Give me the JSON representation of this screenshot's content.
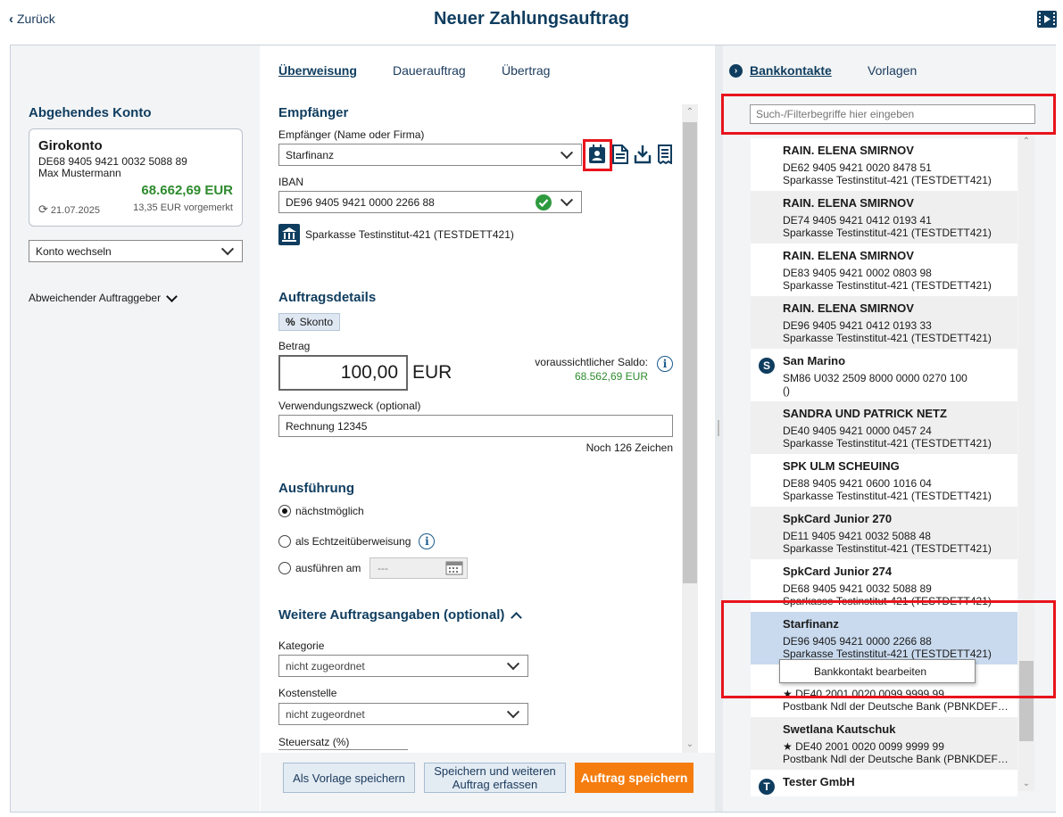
{
  "header": {
    "back_label": "Zurück",
    "title": "Neuer Zahlungsauftrag",
    "media_icon": "film-icon"
  },
  "left": {
    "section_title": "Abgehendes Konto",
    "account": {
      "name": "Girokonto",
      "iban": "DE68 9405 9421 0032 5088 89",
      "holder": "Max Mustermann",
      "balance": "68.662,69 EUR",
      "date": "21.07.2025",
      "preregistered": "13,35 EUR vorgemerkt"
    },
    "switch_account": "Konto wechseln",
    "deviating_payer": "Abweichender Auftraggeber"
  },
  "middle": {
    "tabs": [
      "Überweisung",
      "Dauerauftrag",
      "Übertrag"
    ],
    "recipient": {
      "title": "Empfänger",
      "name_label": "Empfänger (Name oder Firma)",
      "name_value": "Starfinanz",
      "iban_label": "IBAN",
      "iban_value": "DE96 9405 9421 0000 2266 88",
      "bank": "Sparkasse Testinstitut-421  (TESTDETT421)"
    },
    "details": {
      "title": "Auftragsdetails",
      "skonto": "Skonto",
      "amount_label": "Betrag",
      "amount_value": "100,00",
      "currency": "EUR",
      "expected_balance_label": "voraussichtlicher Saldo:",
      "expected_balance_value": "68.562,69 EUR",
      "purpose_label": "Verwendungszweck (optional)",
      "purpose_value": "Rechnung 12345",
      "chars_left": "Noch 126 Zeichen"
    },
    "execution": {
      "title": "Ausführung",
      "options": [
        "nächstmöglich",
        "als Echtzeitüberweisung",
        "ausführen am"
      ],
      "selected_index": 0,
      "date_placeholder": "---"
    },
    "further": {
      "title": "Weitere Auftragsangaben (optional)",
      "category_label": "Kategorie",
      "category_value": "nicht zugeordnet",
      "cost_center_label": "Kostenstelle",
      "cost_center_value": "nicht zugeordnet",
      "tax_label": "Steuersatz (%)"
    },
    "buttons": {
      "save_template": "Als Vorlage speichern",
      "save_and_more_1": "Speichern und weiteren",
      "save_and_more_2": "Auftrag erfassen",
      "save_order": "Auftrag speichern"
    }
  },
  "right": {
    "tabs": [
      "Bankkontakte",
      "Vorlagen"
    ],
    "search_placeholder": "Such-/Filterbegriffe hier eingeben",
    "contacts": [
      {
        "name": "RAIN. ELENA SMIRNOV",
        "iban": "DE62 9405 9421 0020 8478 51",
        "bank": "Sparkasse Testinstitut-421 (TESTDETT421)",
        "badge": ""
      },
      {
        "name": "RAIN. ELENA SMIRNOV",
        "iban": "DE74 9405 9421 0412 0193 41",
        "bank": "Sparkasse Testinstitut-421 (TESTDETT421)",
        "badge": ""
      },
      {
        "name": "RAIN. ELENA SMIRNOV",
        "iban": "DE83 9405 9421 0002 0803 98",
        "bank": "Sparkasse Testinstitut-421 (TESTDETT421)",
        "badge": ""
      },
      {
        "name": "RAIN. ELENA SMIRNOV",
        "iban": "DE96 9405 9421 0412 0193 33",
        "bank": "Sparkasse Testinstitut-421 (TESTDETT421)",
        "badge": ""
      },
      {
        "name": "San Marino",
        "iban": "SM86 U032 2509 8000 0000 0270 100",
        "bank": " ()",
        "badge": "S"
      },
      {
        "name": "SANDRA UND PATRICK NETZ",
        "iban": "DE40 9405 9421 0000 0457 24",
        "bank": "Sparkasse Testinstitut-421 (TESTDETT421)",
        "badge": ""
      },
      {
        "name": "SPK ULM SCHEUING",
        "iban": "DE88 9405 9421 0600 1016 04",
        "bank": "Sparkasse Testinstitut-421 (TESTDETT421)",
        "badge": ""
      },
      {
        "name": "SpkCard Junior 270",
        "iban": "DE11 9405 9421 0032 5088 48",
        "bank": "Sparkasse Testinstitut-421 (TESTDETT421)",
        "badge": ""
      },
      {
        "name": "SpkCard Junior 274",
        "iban": "DE68 9405 9421 0032 5088 89",
        "bank": "Sparkasse Testinstitut-421 (TESTDETT421)",
        "badge": ""
      },
      {
        "name": "Starfinanz",
        "iban": "DE96 9405 9421 0000 2266 88",
        "bank": "Sparkasse Testinstitut-421 (TESTDETT421)",
        "badge": ""
      },
      {
        "name": "",
        "iban": "★ DE40 2001 0020 0099 9999 99",
        "bank": "Postbank Ndl der Deutsche Bank (PBNKDEF…",
        "badge": ""
      },
      {
        "name": "Swetlana Kautschuk",
        "iban": "★ DE40 2001 0020 0099 9999 99",
        "bank": "Postbank Ndl der Deutsche Bank (PBNKDEF…",
        "badge": ""
      },
      {
        "name": "Tester GmbH",
        "iban": "",
        "bank": "",
        "badge": "T"
      }
    ],
    "context_menu_item": "Bankkontakt bearbeiten"
  },
  "colors": {
    "brand_dark": "#0f3d5f",
    "positive": "#2e8b2e",
    "primary_button": "#f57d0f",
    "highlight_frame": "#e8141c",
    "selected_row": "#c9daee"
  }
}
